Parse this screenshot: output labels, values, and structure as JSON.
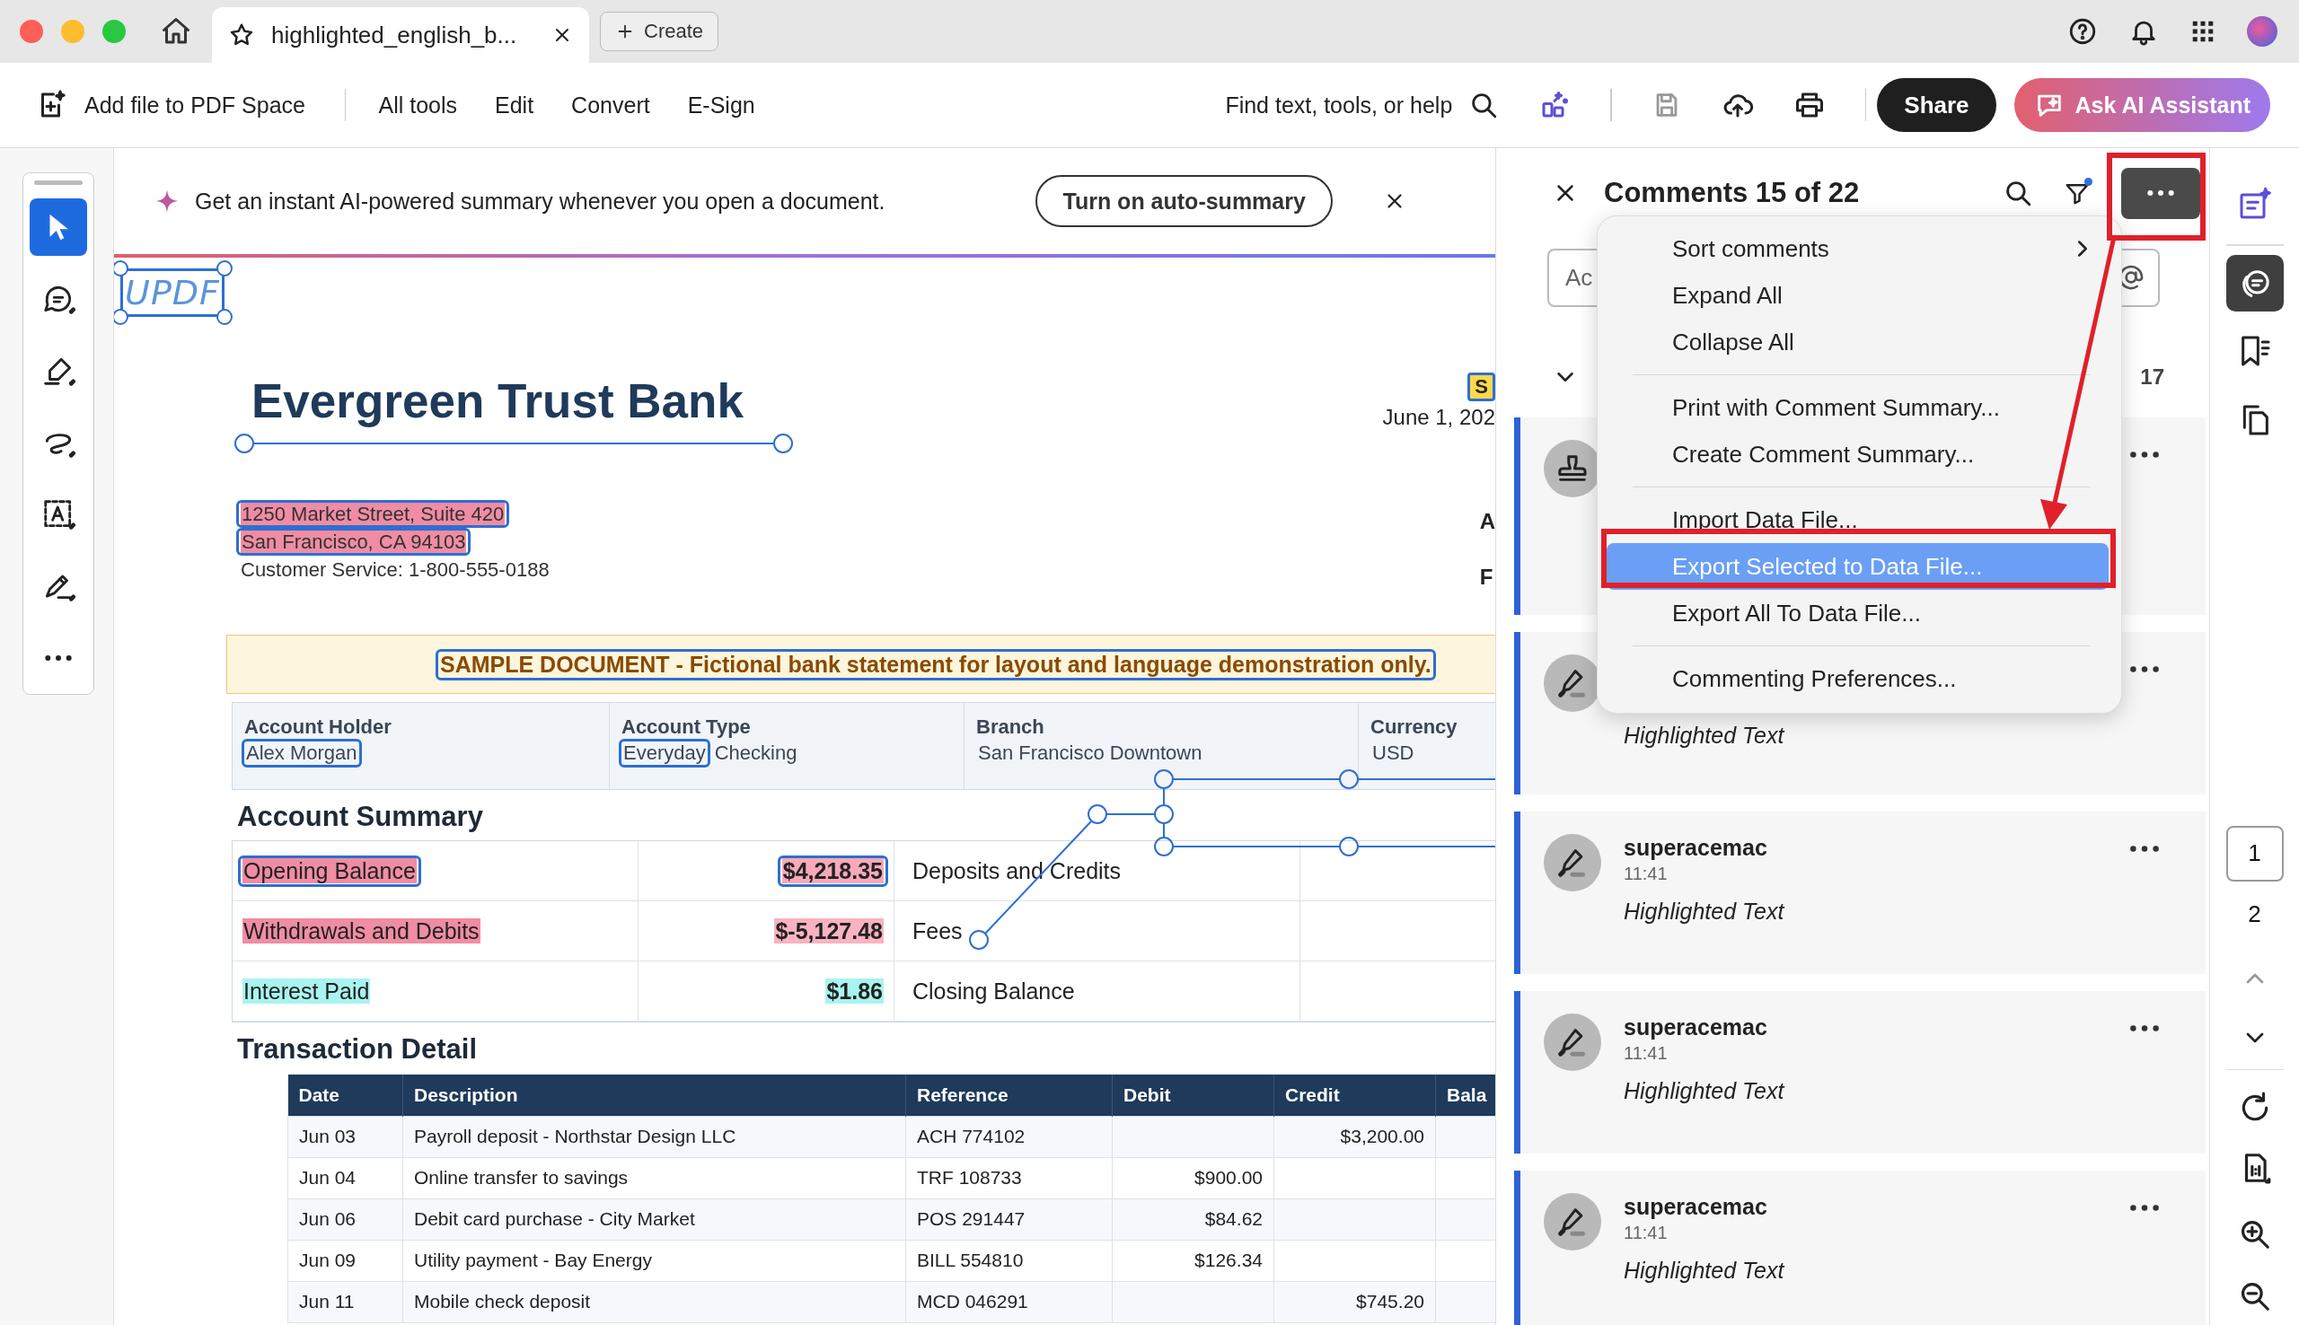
{
  "tab_bar": {
    "tabs": [
      {
        "label": "highlighted_english_b...",
        "selected": true
      }
    ],
    "create_button": "Create"
  },
  "toolbar": {
    "add_file": "Add file to PDF Space",
    "menu": [
      "All tools",
      "Edit",
      "Convert",
      "E-Sign"
    ],
    "search_hint": "Find text, tools, or help",
    "share": "Share",
    "ai_assistant": "Ask AI Assistant"
  },
  "tools": [
    {
      "kind": "select",
      "selected": true
    },
    {
      "kind": "comment",
      "selected": false
    },
    {
      "kind": "highlight",
      "selected": false
    },
    {
      "kind": "draw",
      "selected": false
    },
    {
      "kind": "text",
      "selected": false
    },
    {
      "kind": "sign",
      "selected": false
    },
    {
      "kind": "more",
      "selected": false
    }
  ],
  "banner": {
    "text": "Get an instant AI-powered summary whenever you open a document.",
    "button": "Turn on auto-summary"
  },
  "document": {
    "stamp": {
      "text": "UPDF",
      "selected": true
    },
    "bank_name": "Evergreen Trust Bank",
    "badge": "S",
    "date": "June 1, 202",
    "edge_letters": [
      "A",
      "F"
    ],
    "address": [
      {
        "text": "1250 Market Street, Suite 420",
        "color": "#f08ca4",
        "selected": true
      },
      {
        "text": "San Francisco, CA 94103",
        "color": "#f08ca4",
        "selected": true
      },
      {
        "text": "Customer Service: 1-800-555-0188",
        "selected": false
      }
    ],
    "notice": {
      "text": "SAMPLE DOCUMENT - Fictional bank statement for layout and language demonstration only.",
      "selected": true
    },
    "account_info": [
      {
        "label": "Account Holder",
        "parts": [
          {
            "text": "Alex Morgan",
            "selected": true
          }
        ]
      },
      {
        "label": "Account Type",
        "parts": [
          {
            "text": "Everyday",
            "selected": true
          },
          {
            "text": "Checking",
            "selected": false
          }
        ]
      },
      {
        "label": "Branch",
        "parts": [
          {
            "text": "San Francisco Downtown",
            "selected": false
          }
        ]
      },
      {
        "label": "Currency",
        "parts": [
          {
            "text": "USD",
            "selected": false
          }
        ]
      }
    ],
    "summary": {
      "title": "Account Summary",
      "rows": [
        {
          "label": {
            "text": "Opening Balance",
            "color": "#f08ca4"
          },
          "amount": {
            "text": "$4,218.35",
            "color": "#f7a9ba"
          },
          "selected": true,
          "description": "Deposits and Credits"
        },
        {
          "label": {
            "text": "Withdrawals and Debits",
            "color": "#f08ca4"
          },
          "amount": {
            "text": "$-5,127.48",
            "color": "#fbb2c1"
          },
          "selected": false,
          "description": "Fees"
        },
        {
          "label": {
            "text": "Interest Paid",
            "color": "#a8f4ef"
          },
          "amount": {
            "text": "$1.86",
            "color": "#a8f4ef"
          },
          "selected": false,
          "description": "Closing Balance"
        }
      ]
    },
    "transactions": {
      "title": "Transaction Detail",
      "columns": [
        "Date",
        "Description",
        "Reference",
        "Debit",
        "Credit",
        "Bala"
      ],
      "rows": [
        {
          "date": "Jun 03",
          "description": "Payroll deposit - Northstar Design LLC",
          "reference": "ACH 774102",
          "credit": "$3,200.00"
        },
        {
          "date": "Jun 04",
          "description": "Online transfer to savings",
          "reference": "TRF 108733",
          "debit": "$900.00"
        },
        {
          "date": "Jun 06",
          "description": "Debit card purchase - City Market",
          "reference": "POS 291447",
          "debit": "$84.62"
        },
        {
          "date": "Jun 09",
          "description": "Utility payment - Bay Energy",
          "reference": "BILL 554810",
          "debit": "$126.34"
        },
        {
          "date": "Jun 11",
          "description": "Mobile check deposit",
          "reference": "MCD 046291",
          "credit": "$745.20"
        }
      ]
    }
  },
  "comments_panel": {
    "title": "Comments 15 of 22",
    "input_placeholder": "Ac",
    "count": "17",
    "cards": [
      {
        "kind": "stamp"
      },
      {
        "kind": "highlight",
        "text": "Highlighted Text"
      },
      {
        "kind": "highlight",
        "author": "superacemac",
        "time": "11:41",
        "text": "Highlighted Text"
      },
      {
        "kind": "highlight",
        "author": "superacemac",
        "time": "11:41",
        "text": "Highlighted Text"
      },
      {
        "kind": "highlight",
        "author": "superacemac",
        "time": "11:41",
        "text": "Highlighted Text"
      }
    ]
  },
  "more_menu": {
    "groups": [
      [
        {
          "label": "Sort comments",
          "submenu": true,
          "selected": false
        },
        {
          "label": "Expand All",
          "submenu": false,
          "selected": false
        },
        {
          "label": "Collapse All",
          "submenu": false,
          "selected": false
        }
      ],
      [
        {
          "label": "Print with Comment Summary...",
          "submenu": false,
          "selected": false
        },
        {
          "label": "Create Comment Summary...",
          "submenu": false,
          "selected": false
        }
      ],
      [
        {
          "label": "Import Data File...",
          "submenu": false,
          "selected": false
        },
        {
          "label": "Export Selected to Data File...",
          "submenu": false,
          "selected": true
        },
        {
          "label": "Export All To Data File...",
          "submenu": false,
          "selected": false
        }
      ],
      [
        {
          "label": "Commenting Preferences...",
          "submenu": false,
          "selected": false
        }
      ]
    ]
  },
  "right_rail": {
    "tools": [
      {
        "kind": "ai-edit",
        "selected": false
      },
      {
        "kind": "comments",
        "selected": true
      },
      {
        "kind": "bookmarks",
        "selected": false
      },
      {
        "kind": "pages",
        "selected": false
      }
    ],
    "pages": [
      {
        "label": "1",
        "selected": true
      },
      {
        "label": "2",
        "selected": false
      }
    ]
  }
}
